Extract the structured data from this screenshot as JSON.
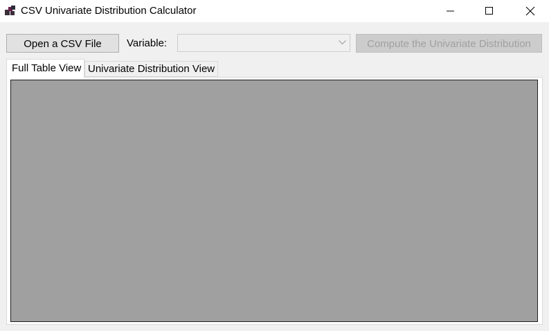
{
  "window": {
    "title": "CSV Univariate Distribution Calculator",
    "icon": "app-icon",
    "controls": [
      "minimize-icon",
      "maximize-icon",
      "close-icon"
    ]
  },
  "toolbar": {
    "open_label": "Open a CSV File",
    "variable_label": "Variable:",
    "variable_value": "",
    "compute_label": "Compute the Univariate Distribution"
  },
  "tabs": [
    {
      "label": "Full Table View",
      "selected": true
    },
    {
      "label": "Univariate Distribution View",
      "selected": false
    }
  ],
  "colors": {
    "grid_background": "#a0a0a0",
    "window_background": "#f0f0f0",
    "disabled_text": "#a0a0a0"
  }
}
